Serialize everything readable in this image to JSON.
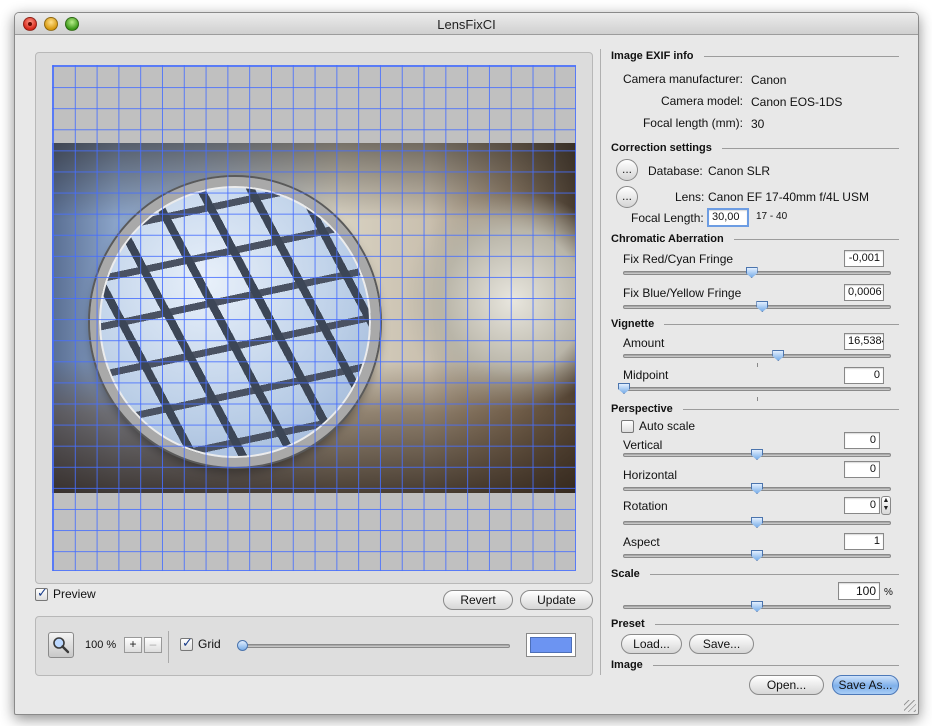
{
  "window": {
    "title": "LensFixCI"
  },
  "preview": {
    "preview_label": "Preview",
    "preview_checked": true,
    "revert_label": "Revert",
    "update_label": "Update"
  },
  "toolbar": {
    "zoom_icon": "magnifier-icon",
    "zoom_level": "100 %",
    "zoom_in": "+",
    "zoom_out": "–",
    "grid_label": "Grid",
    "grid_checked": true,
    "grid_color": "#6c94f2"
  },
  "exif": {
    "section": "Image EXIF info",
    "manufacturer_label": "Camera manufacturer:",
    "manufacturer": "Canon",
    "model_label": "Camera model:",
    "model": "Canon EOS-1DS",
    "focal_label": "Focal length (mm):",
    "focal": "30"
  },
  "correction": {
    "section": "Correction settings",
    "database_button": "...",
    "database_label": "Database:",
    "database": "Canon SLR",
    "lens_button": "...",
    "lens_label": "Lens:",
    "lens": "Canon EF 17-40mm f/4L USM",
    "focal_label": "Focal Length:",
    "focal_value": "30,00",
    "focal_range": "17 - 40"
  },
  "chromatic": {
    "section": "Chromatic Aberration",
    "red_label": "Fix Red/Cyan Fringe",
    "red_value": "-0,001",
    "red_level": 0.48,
    "blue_label": "Fix Blue/Yellow Fringe",
    "blue_value": "0,0006",
    "blue_level": 0.52
  },
  "vignette": {
    "section": "Vignette",
    "amount_label": "Amount",
    "amount_value": "16,5384",
    "amount_level": 0.58,
    "midpoint_label": "Midpoint",
    "midpoint_value": "0",
    "midpoint_level": 0.0
  },
  "perspective": {
    "section": "Perspective",
    "autoscale_label": "Auto scale",
    "autoscale_checked": false,
    "vertical_label": "Vertical",
    "vertical_value": "0",
    "vertical_level": 0.5,
    "horizontal_label": "Horizontal",
    "horizontal_value": "0",
    "horizontal_level": 0.5,
    "rotation_label": "Rotation",
    "rotation_value": "0",
    "rotation_level": 0.5,
    "aspect_label": "Aspect",
    "aspect_value": "1",
    "aspect_level": 0.5
  },
  "scale": {
    "section": "Scale",
    "value": "100",
    "unit": "%",
    "level": 0.5
  },
  "preset": {
    "section": "Preset",
    "load_label": "Load...",
    "save_label": "Save..."
  },
  "image": {
    "section": "Image",
    "open_label": "Open...",
    "save_as_label": "Save As..."
  }
}
